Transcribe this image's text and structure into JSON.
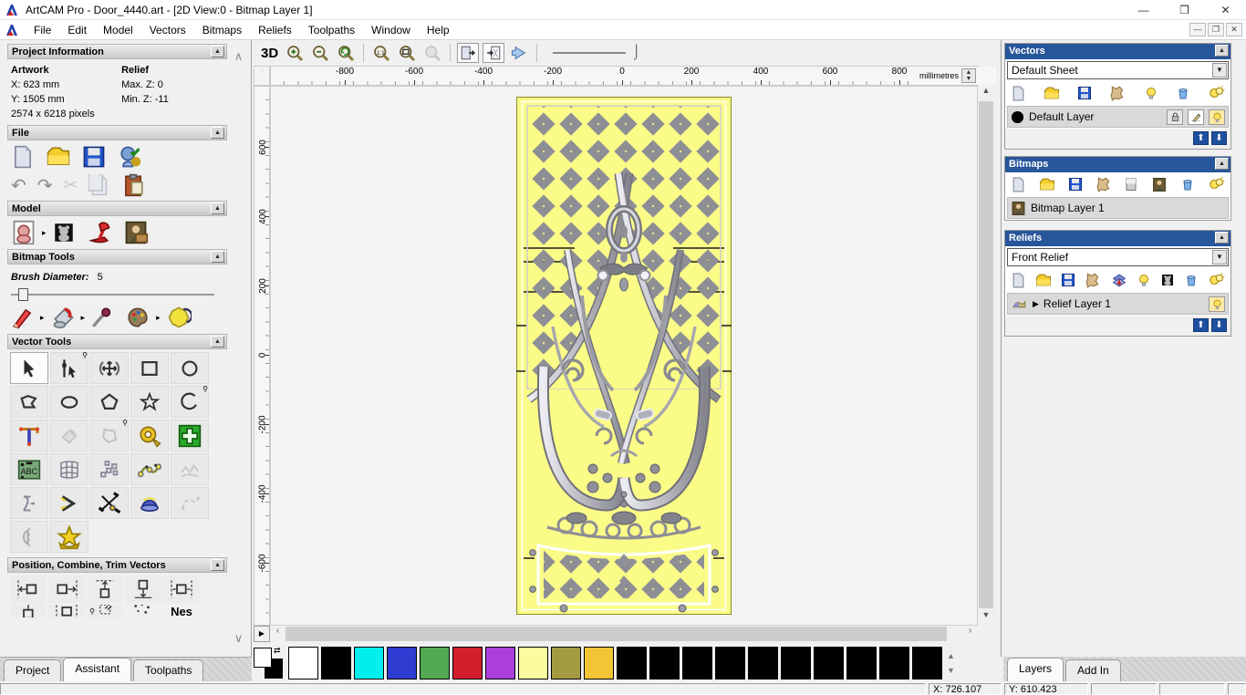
{
  "window": {
    "title": "ArtCAM Pro - Door_4440.art - [2D View:0 - Bitmap Layer 1]"
  },
  "menubar": {
    "items": [
      "File",
      "Edit",
      "Model",
      "Vectors",
      "Bitmaps",
      "Reliefs",
      "Toolpaths",
      "Window",
      "Help"
    ]
  },
  "assistant": {
    "project_information": {
      "title": "Project Information",
      "artwork_heading": "Artwork",
      "relief_heading": "Relief",
      "x": "X: 623 mm",
      "y": "Y: 1505 mm",
      "max_z": "Max. Z: 0",
      "min_z": "Min. Z: -11",
      "pixels": "2574 x 6218 pixels"
    },
    "file_section": {
      "title": "File"
    },
    "model_section": {
      "title": "Model"
    },
    "bitmap_tools": {
      "title": "Bitmap Tools",
      "brush_label": "Brush Diameter:",
      "brush_value": "5"
    },
    "vector_tools": {
      "title": "Vector Tools"
    },
    "position_section": {
      "title": "Position, Combine, Trim Vectors",
      "nesting_label": "Nes"
    },
    "tabs": [
      {
        "label": "Project"
      },
      {
        "label": "Assistant"
      },
      {
        "label": "Toolpaths"
      }
    ]
  },
  "canvas": {
    "toolbar": {
      "view_3d": "3D"
    },
    "ruler_units": "millimetres",
    "ruler_h": [
      "-800",
      "-600",
      "-400",
      "-200",
      "0",
      "200",
      "400",
      "600",
      "800"
    ],
    "ruler_v": [
      "600",
      "400",
      "200",
      "0",
      "-200",
      "-400",
      "-600"
    ]
  },
  "palette": {
    "swatches": [
      "#ffffff",
      "#000000",
      "#00eeee",
      "#2e3cd2",
      "#53a853",
      "#d21f2e",
      "#ab3edd",
      "#fbfa9e",
      "#a39b41",
      "#f2c436",
      "#000000",
      "#000000",
      "#000000",
      "#000000",
      "#000000",
      "#000000",
      "#000000",
      "#000000",
      "#000000",
      "#000000"
    ]
  },
  "layers_panel": {
    "vectors": {
      "title": "Vectors",
      "sheet": "Default Sheet",
      "layer": "Default Layer"
    },
    "bitmaps": {
      "title": "Bitmaps",
      "layer": "Bitmap Layer 1"
    },
    "reliefs": {
      "title": "Reliefs",
      "relief": "Front Relief",
      "layer": "Relief Layer 1"
    },
    "tabs": [
      {
        "label": "Layers"
      },
      {
        "label": "Add In"
      }
    ]
  },
  "statusbar": {
    "x": "X: 726.107",
    "y": "Y: 610.423"
  },
  "colors": {
    "header_blue": "#27569b",
    "door_yellow": "#fbfb88",
    "lattice_gray": "#8e8f95",
    "silver": "#c9c9d1"
  },
  "icons": {
    "app": "artcam-logo",
    "collapse": "collapse-arrow-icon",
    "visibility": "bulb-icon",
    "delete": "trash-icon"
  }
}
